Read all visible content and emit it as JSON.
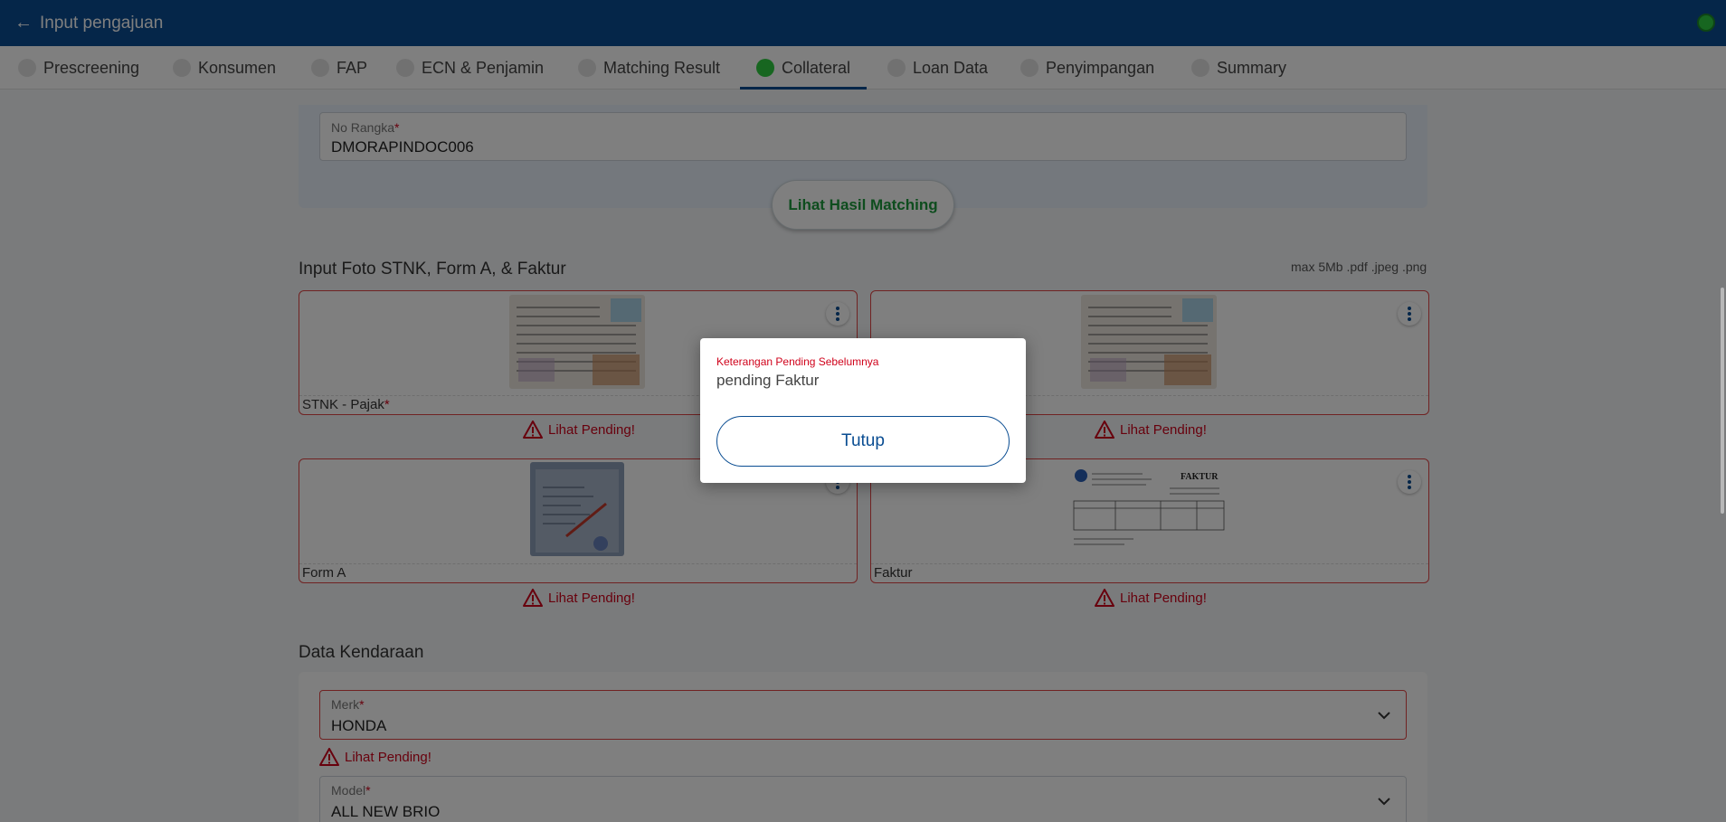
{
  "header": {
    "title": "Input pengajuan"
  },
  "tabs": [
    {
      "label": "Prescreening",
      "active": false
    },
    {
      "label": "Konsumen",
      "active": false
    },
    {
      "label": "FAP",
      "active": false
    },
    {
      "label": "ECN & Penjamin",
      "active": false
    },
    {
      "label": "Matching Result",
      "active": false
    },
    {
      "label": "Collateral",
      "active": true
    },
    {
      "label": "Loan Data",
      "active": false
    },
    {
      "label": "Penyimpangan",
      "active": false
    },
    {
      "label": "Summary",
      "active": false
    }
  ],
  "no_rangka": {
    "label": "No Rangka",
    "required_mark": "*",
    "value": "DMORAPINDOC006"
  },
  "matching_button": "Lihat Hasil Matching",
  "photo_section": {
    "title": "Input Foto STNK, Form A, & Faktur",
    "hint": "max 5Mb .pdf .jpeg .png",
    "cards": [
      {
        "label": "STNK - Pajak",
        "required_mark": "*",
        "pending": "Lihat Pending!"
      },
      {
        "label": "",
        "required_mark": "",
        "pending": "Lihat Pending!"
      },
      {
        "label": "Form A",
        "required_mark": "",
        "pending": "Lihat Pending!"
      },
      {
        "label": "Faktur",
        "required_mark": "",
        "pending": "Lihat Pending!"
      }
    ]
  },
  "vehicle": {
    "title": "Data Kendaraan",
    "merk": {
      "label": "Merk",
      "required_mark": "*",
      "value": "HONDA",
      "pending": "Lihat Pending!"
    },
    "model": {
      "label": "Model",
      "required_mark": "*",
      "value": "ALL NEW BRIO"
    }
  },
  "dialog": {
    "label": "Keterangan Pending Sebelumnya",
    "value": "pending Faktur",
    "close_label": "Tutup"
  },
  "faktur_doc_heading": "FAKTUR",
  "colors": {
    "primary": "#0a4d92",
    "success": "#2ecc40",
    "error": "#d0021b"
  }
}
